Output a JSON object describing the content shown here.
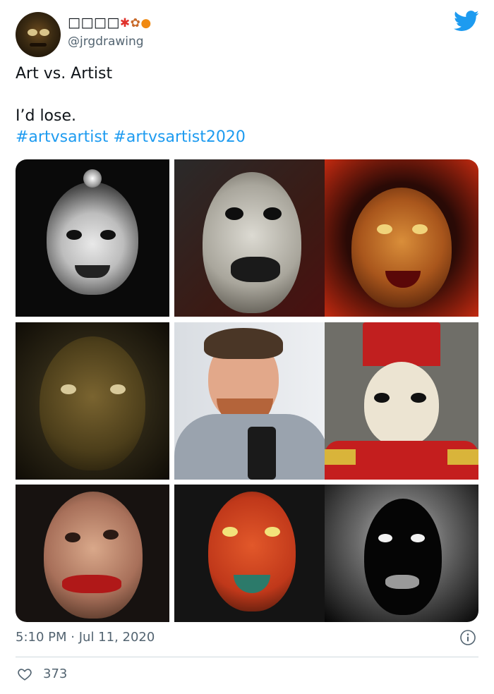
{
  "user": {
    "display_name_boxes": "□□□□",
    "display_name_emojis": [
      "maple-leaf",
      "fallen-leaves",
      "jack-o-lantern"
    ],
    "handle": "@jrgdrawing"
  },
  "tweet": {
    "lines": [
      "Art vs. Artist",
      "",
      "I’d lose."
    ],
    "hashtags": [
      "#artvsartist",
      "#artvsartist2020"
    ]
  },
  "media": {
    "images": [
      {
        "name": "artwork-round-face-bw",
        "bg": "#0a0a0a"
      },
      {
        "name": "artwork-pale-mask",
        "bg": "#3b1a14"
      },
      {
        "name": "artwork-bloody-grin",
        "bg": "#b12010"
      },
      {
        "name": "artwork-murky-face",
        "bg": "#2a2414"
      },
      {
        "name": "artist-selfie",
        "bg": "#e7e9ec"
      },
      {
        "name": "artwork-red-cardinal",
        "bg": "#6f6e68"
      },
      {
        "name": "artwork-smeared-lips",
        "bg": "#171210"
      },
      {
        "name": "artwork-red-demon",
        "bg": "#141414"
      },
      {
        "name": "artwork-ghost-hood",
        "bg": "#050505"
      }
    ]
  },
  "meta": {
    "time": "5:10 PM",
    "separator": "·",
    "date": "Jul 11, 2020"
  },
  "likes": {
    "count": "373"
  },
  "colors": {
    "link": "#1d9bf0",
    "secondary_text": "#536471",
    "brand": "#1d9bf0"
  }
}
